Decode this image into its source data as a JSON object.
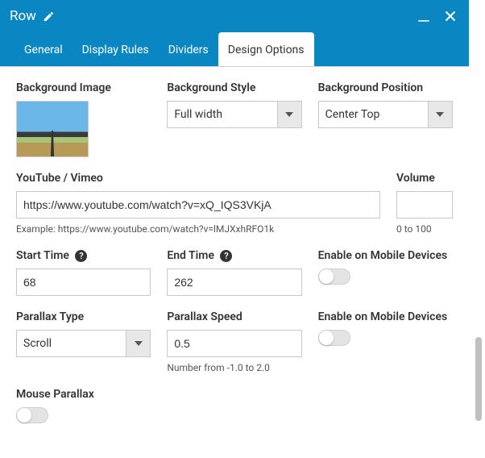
{
  "titlebar": {
    "title": "Row"
  },
  "tabs": {
    "general": "General",
    "display_rules": "Display Rules",
    "dividers": "Dividers",
    "design_options": "Design Options"
  },
  "labels": {
    "bg_image": "Background Image",
    "bg_style": "Background Style",
    "bg_position": "Background Position",
    "youtube": "YouTube / Vimeo",
    "volume": "Volume",
    "start_time": "Start Time",
    "end_time": "End Time",
    "enable_mobile1": "Enable on Mobile Devices",
    "parallax_type": "Parallax Type",
    "parallax_speed": "Parallax Speed",
    "enable_mobile2": "Enable on Mobile Devices",
    "mouse_parallax": "Mouse Parallax"
  },
  "fields": {
    "bg_style_value": "Full width",
    "bg_position_value": "Center Top",
    "youtube_value": "https://www.youtube.com/watch?v=xQ_IQS3VKjA",
    "volume_value": "",
    "start_time_value": "68",
    "end_time_value": "262",
    "parallax_type_value": "Scroll",
    "parallax_speed_value": "0.5"
  },
  "hints": {
    "youtube_example": "Example: https://www.youtube.com/watch?v=lMJXxhRFO1k",
    "volume": "0 to 100",
    "parallax_speed": "Number from -1.0 to 2.0"
  }
}
